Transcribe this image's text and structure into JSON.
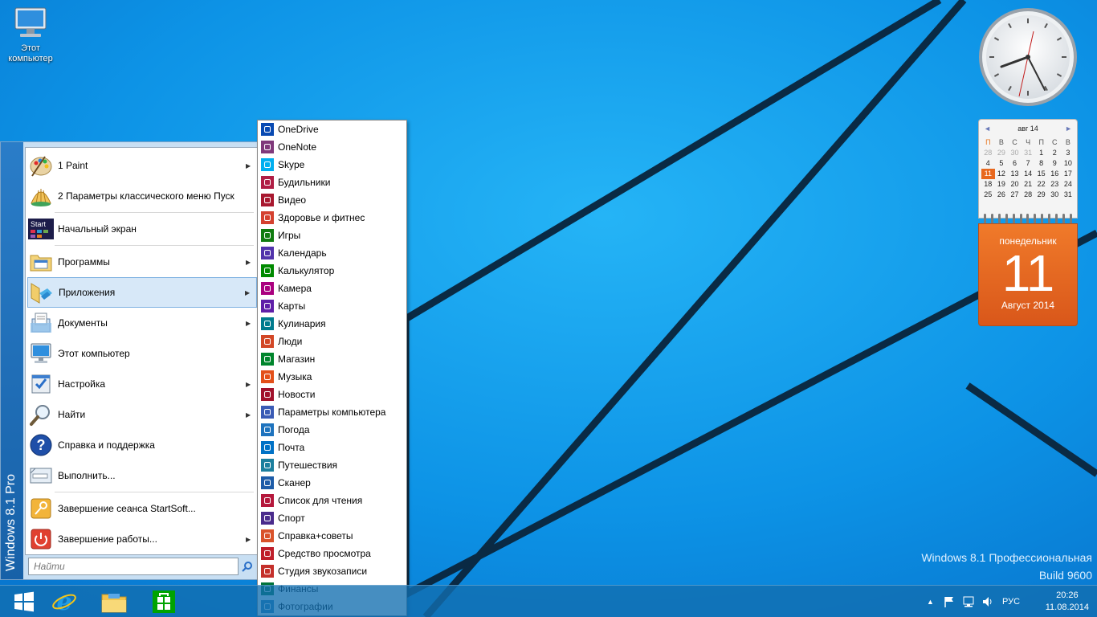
{
  "desktop": {
    "icons": [
      {
        "label_line1": "Этот",
        "label_line2": "компьютер",
        "icon": "computer-icon"
      }
    ]
  },
  "gadgets": {
    "calendar": {
      "month_header": "авг 14",
      "prev": "◄",
      "next": "►",
      "weekdays": [
        "П",
        "В",
        "С",
        "Ч",
        "П",
        "С",
        "В"
      ],
      "weeks": [
        [
          "28",
          "29",
          "30",
          "31",
          "1",
          "2",
          "3"
        ],
        [
          "4",
          "5",
          "6",
          "7",
          "8",
          "9",
          "10"
        ],
        [
          "11",
          "12",
          "13",
          "14",
          "15",
          "16",
          "17"
        ],
        [
          "18",
          "19",
          "20",
          "21",
          "22",
          "23",
          "24"
        ],
        [
          "25",
          "26",
          "27",
          "28",
          "29",
          "30",
          "31"
        ]
      ],
      "today": "11",
      "weekday_name": "понедельник",
      "day_number": "11",
      "month_year": "Август 2014"
    }
  },
  "watermark": {
    "line1": "Windows 8.1 Профессиональная",
    "line2": "Build 9600"
  },
  "start_menu": {
    "side_label": "Windows 8.1 Pro",
    "items": [
      {
        "label": "1 Paint",
        "icon": "paint-palette-icon",
        "has_submenu": true
      },
      {
        "label": "2 Параметры классического меню Пуск",
        "icon": "shell-icon",
        "has_submenu": false
      },
      {
        "label": "Начальный экран",
        "icon": "start-screen-icon",
        "has_submenu": false
      },
      {
        "label": "Программы",
        "icon": "programs-folder-icon",
        "has_submenu": true
      },
      {
        "label": "Приложения",
        "icon": "apps-folder-icon",
        "has_submenu": true
      },
      {
        "label": "Документы",
        "icon": "documents-icon",
        "has_submenu": true
      },
      {
        "label": "Этот компьютер",
        "icon": "computer-icon",
        "has_submenu": false
      },
      {
        "label": "Настройка",
        "icon": "settings-icon",
        "has_submenu": true
      },
      {
        "label": "Найти",
        "icon": "magnifier-icon",
        "has_submenu": true
      },
      {
        "label": "Справка и поддержка",
        "icon": "help-icon",
        "has_submenu": false
      },
      {
        "label": "Выполнить...",
        "icon": "run-icon",
        "has_submenu": false
      },
      {
        "label": "Завершение сеанса StartSoft...",
        "icon": "logoff-key-icon",
        "has_submenu": false
      },
      {
        "label": "Завершение работы...",
        "icon": "power-icon",
        "has_submenu": true
      }
    ],
    "start_tile_text": "Start",
    "search_placeholder": "Найти"
  },
  "apps_submenu": {
    "items": [
      {
        "label": "OneDrive",
        "color": "#094ab2"
      },
      {
        "label": "OneNote",
        "color": "#80397b"
      },
      {
        "label": "Skype",
        "color": "#00aff0"
      },
      {
        "label": "Будильники",
        "color": "#b01e45"
      },
      {
        "label": "Видео",
        "color": "#a8182f"
      },
      {
        "label": "Здоровье и фитнес",
        "color": "#d4412f"
      },
      {
        "label": "Игры",
        "color": "#107c10"
      },
      {
        "label": "Календарь",
        "color": "#5133ab"
      },
      {
        "label": "Калькулятор",
        "color": "#008a00"
      },
      {
        "label": "Камера",
        "color": "#aa007f"
      },
      {
        "label": "Карты",
        "color": "#5f1fa8"
      },
      {
        "label": "Кулинария",
        "color": "#007b8e"
      },
      {
        "label": "Люди",
        "color": "#d24726"
      },
      {
        "label": "Магазин",
        "color": "#00852c"
      },
      {
        "label": "Музыка",
        "color": "#e3501a"
      },
      {
        "label": "Новости",
        "color": "#a1112c"
      },
      {
        "label": "Параметры компьютера",
        "color": "#3a5bb5"
      },
      {
        "label": "Погода",
        "color": "#1e73be"
      },
      {
        "label": "Почта",
        "color": "#0072c6"
      },
      {
        "label": "Путешествия",
        "color": "#1c7f9e"
      },
      {
        "label": "Сканер",
        "color": "#1d5ca8"
      },
      {
        "label": "Список для чтения",
        "color": "#b5183c"
      },
      {
        "label": "Спорт",
        "color": "#4a2b8c"
      },
      {
        "label": "Справка+советы",
        "color": "#d9532b"
      },
      {
        "label": "Средство просмотра",
        "color": "#bf1f2b"
      },
      {
        "label": "Студия звукозаписи",
        "color": "#c4302b"
      },
      {
        "label": "Финансы",
        "color": "#00723a"
      },
      {
        "label": "Фотографии",
        "color": "#2a7fb8"
      }
    ]
  },
  "taskbar": {
    "pinned": [
      "windows-start-icon",
      "internet-explorer-icon",
      "file-explorer-icon",
      "store-icon"
    ],
    "tray": {
      "lang": "РУС",
      "time": "20:26",
      "date": "11.08.2014"
    }
  }
}
